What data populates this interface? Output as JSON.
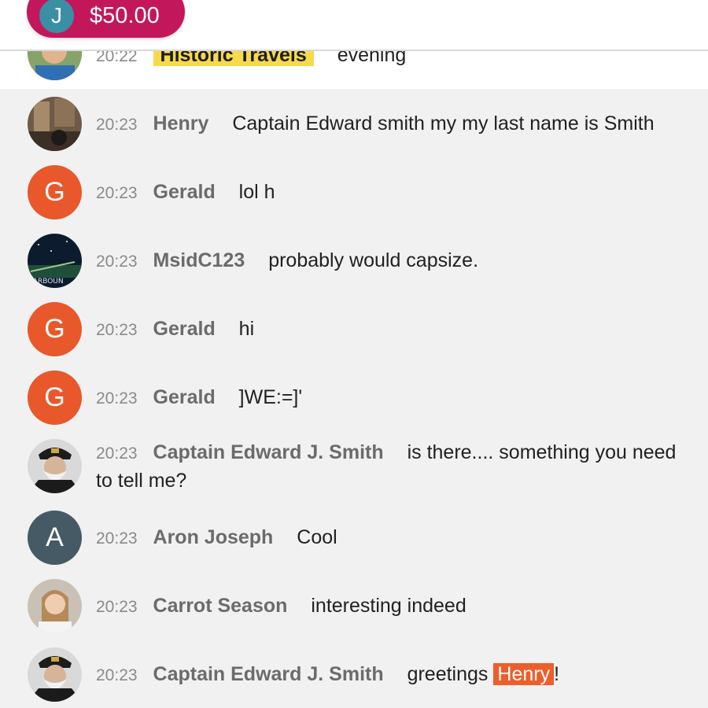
{
  "superchat": {
    "avatar_letter": "J",
    "amount": "$50.00"
  },
  "pinned": {
    "time": "20:22",
    "author": "Historic Travels",
    "text": "evening"
  },
  "messages": [
    {
      "time": "20:23",
      "author": "Henry",
      "text": "Captain Edward smith my my last name is Smith"
    },
    {
      "time": "20:23",
      "author": "Gerald",
      "text": "lol h",
      "avatar_letter": "G"
    },
    {
      "time": "20:23",
      "author": "MsidC123",
      "text": "probably would capsize."
    },
    {
      "time": "20:23",
      "author": "Gerald",
      "text": "hi",
      "avatar_letter": "G"
    },
    {
      "time": "20:23",
      "author": "Gerald",
      "text": "]WE:=]'",
      "avatar_letter": "G"
    },
    {
      "time": "20:23",
      "author": "Captain Edward J. Smith",
      "text": "is there.... something you need to tell me?"
    },
    {
      "time": "20:23",
      "author": "Aron Joseph",
      "text": "Cool",
      "avatar_letter": "A"
    },
    {
      "time": "20:23",
      "author": "Carrot Season",
      "text": "interesting indeed"
    },
    {
      "time": "20:23",
      "author": "Captain Edward J. Smith",
      "text_before": "greetings",
      "mention": "Henry",
      "text_after": "!"
    }
  ],
  "avatar_images": {
    "msidc123_badge": "TARBOUN"
  },
  "colors": {
    "superchat": "#c2185b",
    "letter_avatar_g": "#e8582b",
    "letter_avatar_a": "#455a64",
    "mention": "#ec5f2c",
    "owner_badge": "#f7d94c"
  }
}
